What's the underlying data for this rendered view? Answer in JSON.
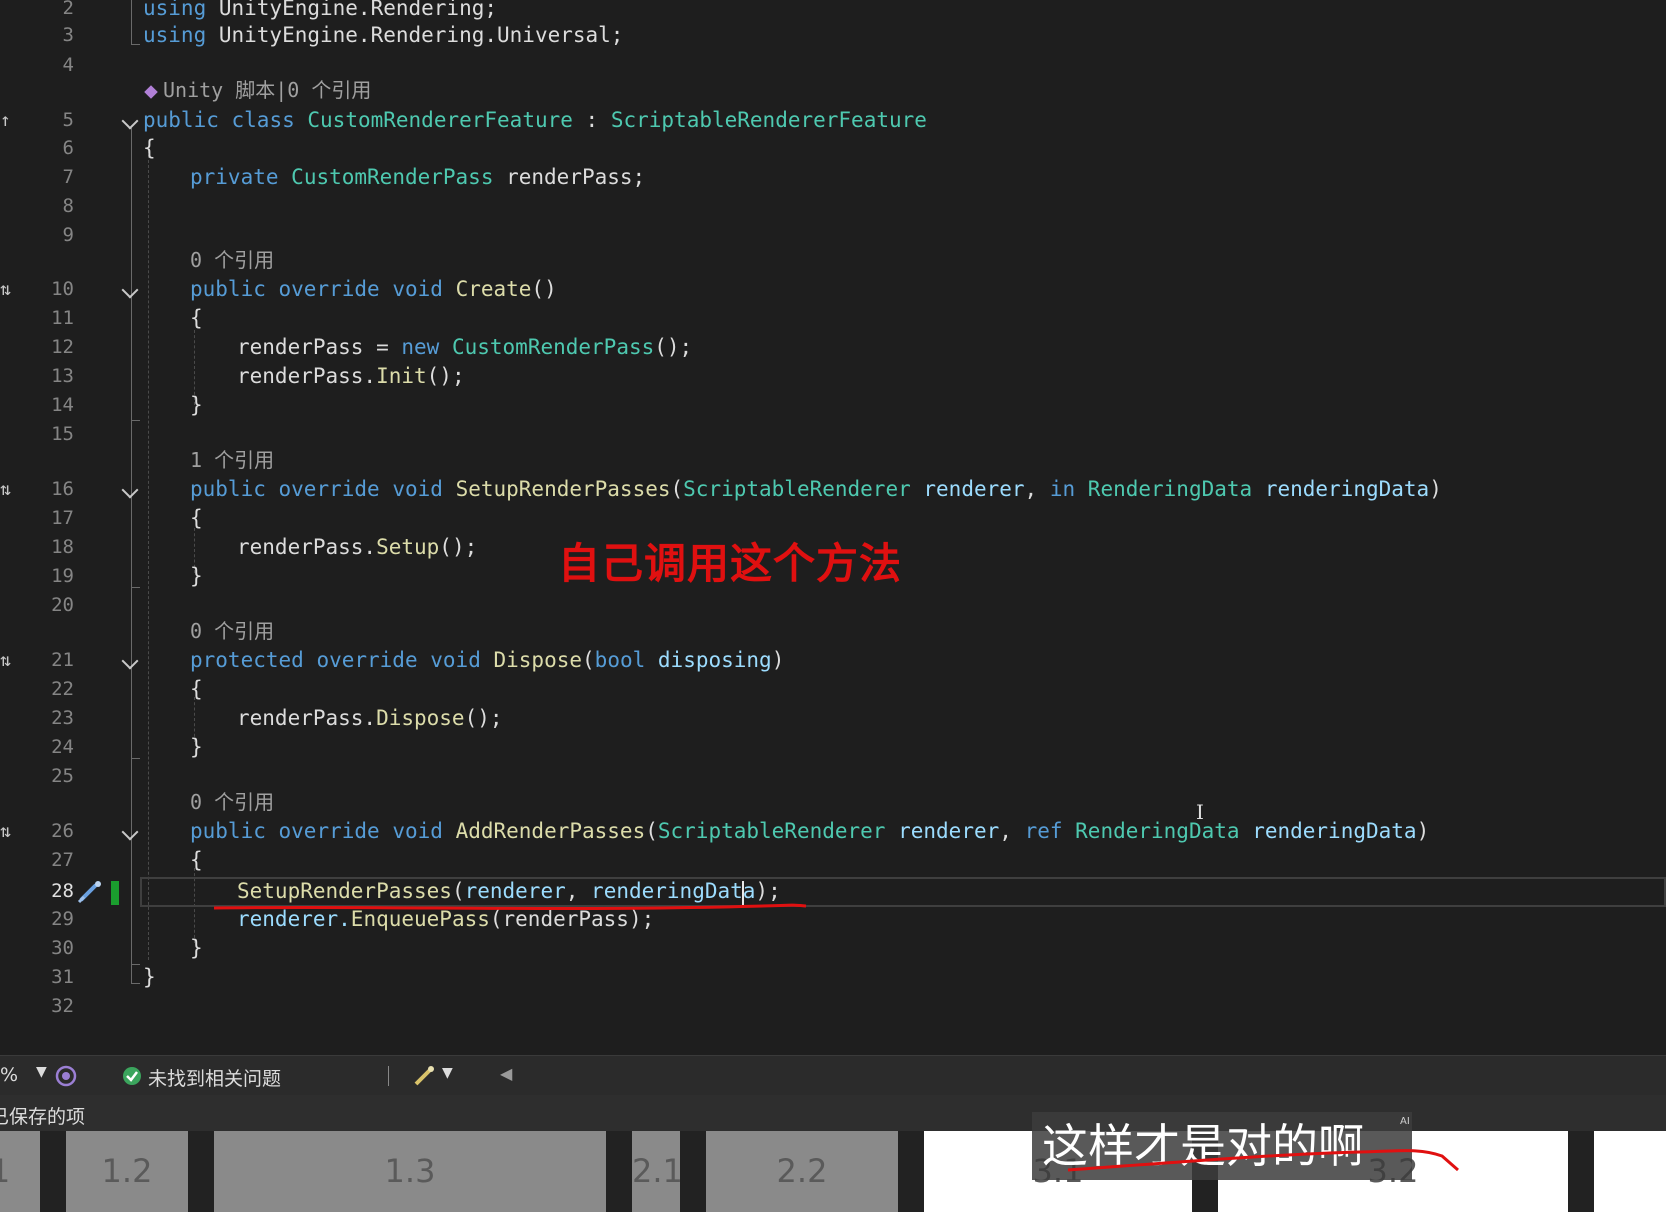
{
  "editor": {
    "lines": {
      "l2": {
        "num": "2",
        "t1": "using",
        "t2": " UnityEngine.Rendering;"
      },
      "l3": {
        "num": "3",
        "t1": "using",
        "t2": " UnityEngine.Rendering.Universal;"
      },
      "l4": {
        "num": "4"
      },
      "lens_unity": "Unity 脚本|0 个引用",
      "l5": {
        "num": "5",
        "t1": "public",
        "t2": " ",
        "t3": "class",
        "t4": " ",
        "t5": "CustomRendererFeature",
        "t6": " : ",
        "t7": "ScriptableRendererFeature"
      },
      "l6": {
        "num": "6",
        "t1": "{"
      },
      "l7": {
        "num": "7",
        "t1": "private",
        "t2": " ",
        "t3": "CustomRenderPass",
        "t4": " renderPass;"
      },
      "l8": {
        "num": "8"
      },
      "l9": {
        "num": "9"
      },
      "lens_create": "0 个引用",
      "l10": {
        "num": "10",
        "t1": "public",
        "t2": " ",
        "t3": "override",
        "t4": " ",
        "t5": "void",
        "t6": " ",
        "t7": "Create",
        "t8": "()"
      },
      "l11": {
        "num": "11",
        "t1": "{"
      },
      "l12": {
        "num": "12",
        "t1": "renderPass = ",
        "t2": "new",
        "t3": " ",
        "t4": "CustomRenderPass",
        "t5": "();"
      },
      "l13": {
        "num": "13",
        "t1": "renderPass.",
        "t2": "Init",
        "t3": "();"
      },
      "l14": {
        "num": "14",
        "t1": "}"
      },
      "l15": {
        "num": "15"
      },
      "lens_setup": "1 个引用",
      "l16": {
        "num": "16",
        "t1": "public",
        "t2": " ",
        "t3": "override",
        "t4": " ",
        "t5": "void",
        "t6": " ",
        "t7": "SetupRenderPasses",
        "t8": "(",
        "t9": "ScriptableRenderer",
        "t10": " ",
        "t11": "renderer",
        "t12": ", ",
        "t13": "in",
        "t14": " ",
        "t15": "RenderingData",
        "t16": " ",
        "t17": "renderingData",
        "t18": ")"
      },
      "l17": {
        "num": "17",
        "t1": "{"
      },
      "l18": {
        "num": "18",
        "t1": "renderPass.",
        "t2": "Setup",
        "t3": "();"
      },
      "l19": {
        "num": "19",
        "t1": "}"
      },
      "l20": {
        "num": "20"
      },
      "lens_dispose": "0 个引用",
      "l21": {
        "num": "21",
        "t1": "protected",
        "t2": " ",
        "t3": "override",
        "t4": " ",
        "t5": "void",
        "t6": " ",
        "t7": "Dispose",
        "t8": "(",
        "t9": "bool",
        "t10": " ",
        "t11": "disposing",
        "t12": ")"
      },
      "l22": {
        "num": "22",
        "t1": "{"
      },
      "l23": {
        "num": "23",
        "t1": "renderPass.",
        "t2": "Dispose",
        "t3": "();"
      },
      "l24": {
        "num": "24",
        "t1": "}"
      },
      "l25": {
        "num": "25"
      },
      "lens_add": "0 个引用",
      "l26": {
        "num": "26",
        "t1": "public",
        "t2": " ",
        "t3": "override",
        "t4": " ",
        "t5": "void",
        "t6": " ",
        "t7": "AddRenderPasses",
        "t8": "(",
        "t9": "ScriptableRenderer",
        "t10": " ",
        "t11": "renderer",
        "t12": ", ",
        "t13": "ref",
        "t14": " ",
        "t15": "RenderingData",
        "t16": " ",
        "t17": "renderingData",
        "t18": ")"
      },
      "l27": {
        "num": "27",
        "t1": "{"
      },
      "l28": {
        "num": "28",
        "t1": "SetupRenderPasses",
        "t2": "(",
        "t3": "renderer",
        "t4": ", ",
        "t5": "renderingData",
        "t6": ");"
      },
      "l29": {
        "num": "29",
        "t1": "renderer.",
        "t2": "EnqueuePass",
        "t3": "(renderPass);"
      },
      "l30": {
        "num": "30",
        "t1": "}"
      },
      "l31": {
        "num": "31",
        "t1": "}"
      },
      "l32": {
        "num": "32"
      }
    },
    "annotation": "自己调用这个方法",
    "ibeam": "I"
  },
  "status_bar": {
    "zoom": "%",
    "issues": "未找到相关问题"
  },
  "output": {
    "label": "已保存的项"
  },
  "timeline": {
    "segments": [
      "1",
      "1.2",
      "1.3",
      "2.1",
      "2.2",
      "3.1",
      "3.2"
    ]
  },
  "subtitle": {
    "text": "这样才是对的啊",
    "badge": "AI"
  }
}
